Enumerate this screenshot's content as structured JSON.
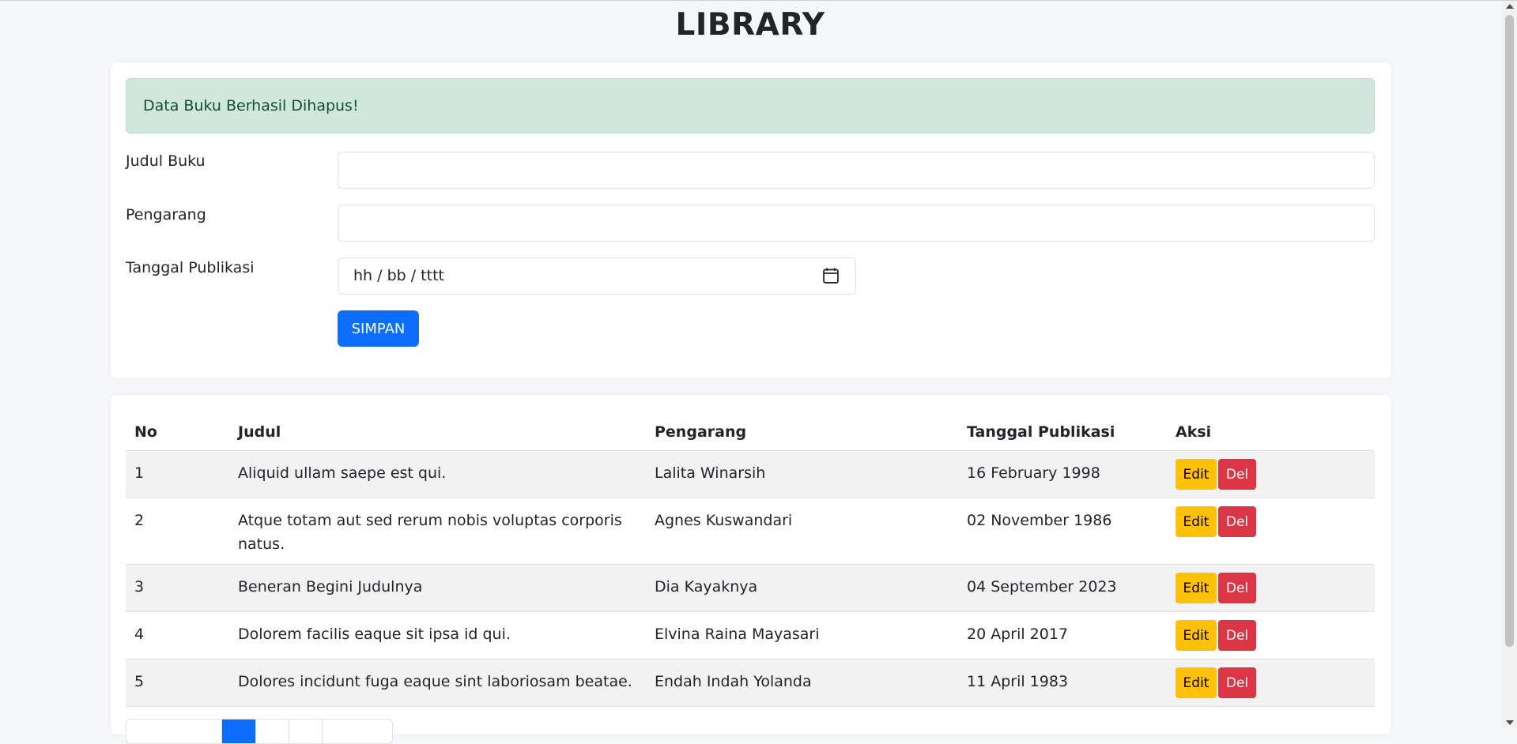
{
  "page": {
    "title": "LIBRARY"
  },
  "alert": {
    "message": "Data Buku Berhasil Dihapus!"
  },
  "form": {
    "title_label": "Judul Buku",
    "title_value": "",
    "author_label": "Pengarang",
    "author_value": "",
    "date_label": "Tanggal Publikasi",
    "date_placeholder": "hh / bb / tttt",
    "date_icon": "calendar-icon",
    "save_label": "SIMPAN"
  },
  "table": {
    "headers": {
      "no": "No",
      "title": "Judul",
      "author": "Pengarang",
      "date": "Tanggal Publikasi",
      "actions": "Aksi"
    },
    "edit_label": "Edit",
    "delete_label": "Del",
    "rows": [
      {
        "no": "1",
        "title": "Aliquid ullam saepe est qui.",
        "author": "Lalita Winarsih",
        "date": "16 February 1998"
      },
      {
        "no": "2",
        "title": "Atque totam aut sed rerum nobis voluptas corporis natus.",
        "author": "Agnes Kuswandari",
        "date": "02 November 1986"
      },
      {
        "no": "3",
        "title": "Beneran Begini Judulnya",
        "author": "Dia Kayaknya",
        "date": "04 September 2023"
      },
      {
        "no": "4",
        "title": "Dolorem facilis eaque sit ipsa id qui.",
        "author": "Elvina Raina Mayasari",
        "date": "20 April 2017"
      },
      {
        "no": "5",
        "title": "Dolores incidunt fuga eaque sint laboriosam beatae.",
        "author": "Endah Indah Yolanda",
        "date": "11 April 1983"
      }
    ]
  },
  "colors": {
    "primary": "#0d6efd",
    "warning": "#ffc107",
    "danger": "#dc3545",
    "success_bg": "#d1e7dd",
    "success_text": "#0f5132"
  }
}
